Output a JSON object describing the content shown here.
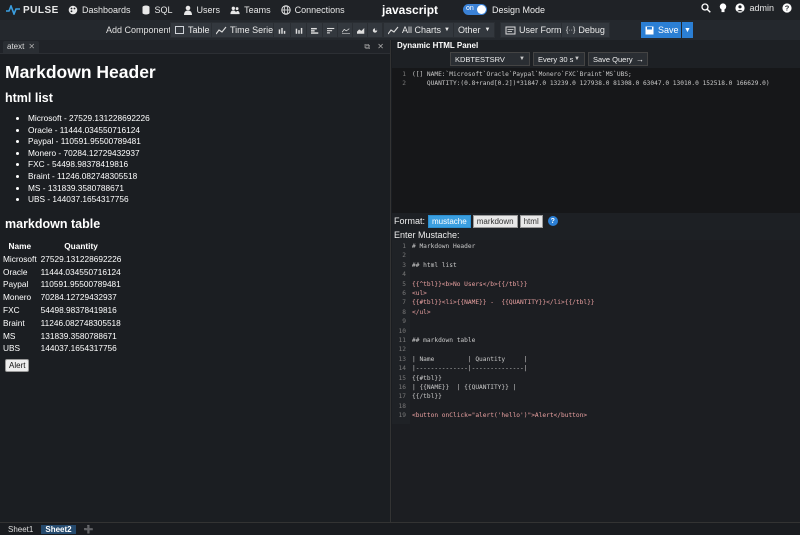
{
  "nav": {
    "logo": "PULSE",
    "items": [
      {
        "label": "Dashboards",
        "icon": "palette-icon"
      },
      {
        "label": "SQL",
        "icon": "database-icon"
      },
      {
        "label": "Users",
        "icon": "user-icon"
      },
      {
        "label": "Teams",
        "icon": "users-icon"
      },
      {
        "label": "Connections",
        "icon": "globe-icon"
      }
    ],
    "title": "javascript",
    "toggle_label": "on",
    "design_mode": "Design Mode",
    "user": "admin"
  },
  "toolbar": {
    "add_label": "Add Component:",
    "table": "Table",
    "time_series": "Time Series",
    "all_charts": "All Charts",
    "other": "Other",
    "user_form": "User Form",
    "debug": "Debug",
    "save": "Save"
  },
  "left": {
    "tab": "atext",
    "h1": "Markdown Header",
    "h2_list": "html list",
    "list": [
      "Microsoft - 27529.131228692226",
      "Oracle - 11444.034550716124",
      "Paypal - 110591.95500789481",
      "Monero - 70284.12729432937",
      "FXC - 54498.98378419816",
      "Braint - 11246.082748305518",
      "MS - 131839.3580788671",
      "UBS - 144037.1654317756"
    ],
    "h2_table": "markdown table",
    "table_headers": [
      "Name",
      "Quantity"
    ],
    "table_rows": [
      [
        "Microsoft",
        "27529.131228692226"
      ],
      [
        "Oracle",
        "11444.034550716124"
      ],
      [
        "Paypal",
        "110591.95500789481"
      ],
      [
        "Monero",
        "70284.12729432937"
      ],
      [
        "FXC",
        "54498.98378419816"
      ],
      [
        "Braint",
        "11246.082748305518"
      ],
      [
        "MS",
        "131839.3580788671"
      ],
      [
        "UBS",
        "144037.1654317756"
      ]
    ],
    "alert": "Alert"
  },
  "sheets": [
    "Sheet1",
    "Sheet2"
  ],
  "right": {
    "title": "Dynamic HTML Panel",
    "server": "KDBTESTSRV",
    "interval": "Every 30 s",
    "save_query": "Save Query",
    "query_lines": [
      "([] NAME:`Microsoft`Oracle`Paypal`Monero`FXC`Braint`MS`UBS;",
      "    QUANTITY:(0.8+rand[0.2])*31847.0 13239.0 127938.0 81308.0 63047.0 13010.0 152518.0 166629.0)"
    ],
    "format_label": "Format:",
    "formats": [
      "mustache",
      "markdown",
      "html"
    ],
    "enter_label": "Enter Mustache:",
    "template_lines": [
      "# Markdown Header",
      "",
      "## html list",
      "",
      "{{^tbl}}<b>No Users</b>{{/tbl}}",
      "<ul>",
      "{{#tbl}}<li>{{NAME}} -  {{QUANTITY}}</li>{{/tbl}}",
      "</ul>",
      "",
      "",
      "## markdown table",
      "",
      "| Name         | Quantity     |",
      "|--------------|--------------|",
      "{{#tbl}}",
      "| {{NAME}}  | {{QUANTITY}} |",
      "{{/tbl}}",
      "",
      "<button onClick=\"alert('hello')\">Alert</button>"
    ]
  }
}
